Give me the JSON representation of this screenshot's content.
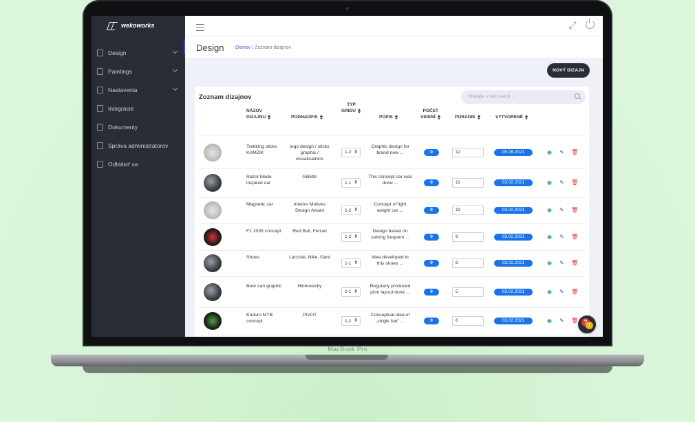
{
  "device_label": "MacBook Pro",
  "logo_text": "wekoworks",
  "sidebar": {
    "items": [
      {
        "label": "Design",
        "icon": "file-icon",
        "chevron": true
      },
      {
        "label": "Paintings",
        "icon": "file-icon",
        "chevron": true
      },
      {
        "label": "Nastavenia",
        "icon": "database-icon",
        "chevron": true
      },
      {
        "label": "Integrácie",
        "icon": "circle-icon",
        "chevron": false
      },
      {
        "label": "Dokumenty",
        "icon": "document-icon",
        "chevron": false
      },
      {
        "label": "Správa administrátorov",
        "icon": "admin-icon",
        "chevron": false
      },
      {
        "label": "Odhlásiť sa",
        "icon": "logout-icon",
        "chevron": false
      }
    ]
  },
  "header": {
    "page_title": "Design",
    "breadcrumb_home": "Domov",
    "breadcrumb_sep": "/",
    "breadcrumb_current": "Zoznam dizajnov"
  },
  "toolbar": {
    "new_button": "NOVÝ DIZAJN"
  },
  "list": {
    "title": "Zoznam dizajnov",
    "search_placeholder": "Hľadajte v tejto sekcii ...",
    "columns": {
      "name_1": "NÁZOV",
      "name_2": "DIZAJNU",
      "subtitle": "PODNADPIS",
      "grid_1": "TYP",
      "grid_2": "GRIDU",
      "desc": "POPIS",
      "views_1": "POČET",
      "views_2": "VIDENÍ",
      "order": "PORADIE",
      "created": "VYTVORENÉ"
    },
    "rows": [
      {
        "name": "Trekking sticks KAMZIK",
        "sub": "logo design / sticks graphic / visualisations",
        "grid": "1-2",
        "desc": "Graphic design for brand new ...",
        "views": "0",
        "order": "12",
        "created": "05.06.2021",
        "thumb": "light"
      },
      {
        "name": "Razor blade inspired car",
        "sub": "Gillette",
        "grid": "1-1",
        "desc": "This concept car was done ...",
        "views": "0",
        "order": "11",
        "created": "03.02.2021",
        "thumb": "dark"
      },
      {
        "name": "Magnetic car",
        "sub": "Interior Motives Design Award",
        "grid": "1-2",
        "desc": "Concept of light weight car ...",
        "views": "0",
        "order": "10",
        "created": "03.02.2021",
        "thumb": "light"
      },
      {
        "name": "F1 2035 concept",
        "sub": "Red Bull, Ferrari",
        "grid": "1-2",
        "desc": "Design based on solving frequent ...",
        "views": "0",
        "order": "9",
        "created": "03.02.2021",
        "thumb": "red"
      },
      {
        "name": "Shoes",
        "sub": "Lacoste, Nike, Gant",
        "grid": "1-1",
        "desc": "Idea developed in this shoes ...",
        "views": "0",
        "order": "8",
        "created": "03.02.2021",
        "thumb": "dark"
      },
      {
        "name": "Beer can graphic",
        "sub": "Hlohovecky",
        "grid": "2-1",
        "desc": "Regularly produced print layout done ...",
        "views": "0",
        "order": "5",
        "created": "03.02.2021",
        "thumb": "dark"
      },
      {
        "name": "Enduro MTB concept",
        "sub": "PIVOT",
        "grid": "1-2",
        "desc": "Conceptual idea of „single bar\" ...",
        "views": "0",
        "order": "6",
        "created": "03.02.2021",
        "thumb": "green"
      }
    ]
  },
  "colors": {
    "sidebar": "#2a2d36",
    "accent": "#1a73e8",
    "view": "#27ae60",
    "delete": "#e53935",
    "breadcrumb_link": "#5a4bd8"
  }
}
